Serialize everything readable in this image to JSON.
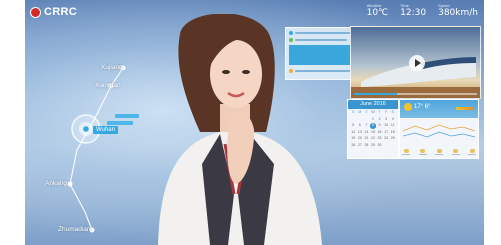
{
  "app": {
    "logo_text": "CRRC"
  },
  "status": [
    {
      "label": "Weather",
      "value": "10℃"
    },
    {
      "label": "Time",
      "value": "12:30"
    },
    {
      "label": "Speed",
      "value": "380km/h"
    }
  ],
  "route": {
    "stops": [
      "Xujiang",
      "Xiangfan",
      "Wuhan",
      "Ankang",
      "Zhumadian"
    ],
    "current_stop": "Wuhan"
  },
  "calendar": {
    "month": "June 2016",
    "weekdays": [
      "S",
      "M",
      "T",
      "W",
      "T",
      "F",
      "S"
    ],
    "days": [
      "",
      "",
      "",
      "1",
      "2",
      "3",
      "4",
      "5",
      "6",
      "7",
      "8",
      "9",
      "10",
      "11",
      "12",
      "13",
      "14",
      "15",
      "16",
      "17",
      "18",
      "19",
      "20",
      "21",
      "22",
      "23",
      "24",
      "25",
      "26",
      "27",
      "28",
      "29",
      "30",
      "",
      ""
    ],
    "today": "8"
  },
  "weather": {
    "temp": "17° 6°"
  },
  "colors": {
    "accent": "#35a7df",
    "logo_red": "#d62a2a"
  },
  "icons": [
    "logo-mark-icon",
    "play-icon",
    "sun-icon"
  ]
}
